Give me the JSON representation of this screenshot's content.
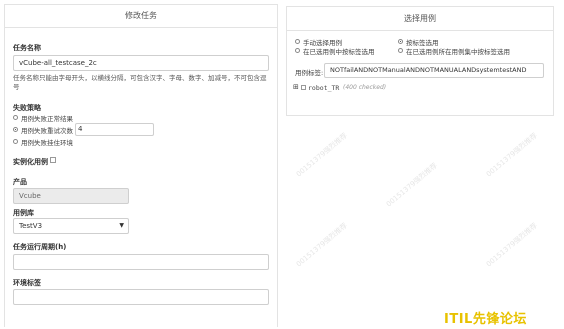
{
  "left_panel": {
    "title": "修改任务",
    "task_name": {
      "label": "任务名称",
      "value": "vCube-all_testcase_2c",
      "hint": "任务名称只能由字母开头，以横线分隔，可包含汉字、字母、数字、加减号，不可包含逗号"
    },
    "fail_strategy": {
      "label": "失败策略",
      "options": [
        "用例失败正常结果",
        "用例失败重试次数",
        "用例失败挂住环境"
      ],
      "selected_index": 1,
      "retry_count": "4"
    },
    "instantiate": {
      "label": "实例化用例"
    },
    "product": {
      "label": "产品",
      "value": "Vcube"
    },
    "case_library": {
      "label": "用例库",
      "value": "TestV3"
    },
    "run_period": {
      "label": "任务运行周期(h)",
      "value": ""
    },
    "env_tag": {
      "label": "环境标签",
      "value": ""
    }
  },
  "right_panel": {
    "title": "选择用例",
    "modes": [
      "手动选择用例",
      "按标签选用",
      "在已选用例中按标签选用",
      "在已选用例所在用例集中按标签选用"
    ],
    "selected_mode_index": 1,
    "tag_label": "用例标签:",
    "tag_value": "NOTfailANDNOTManualANDNOTMANUALANDsystemtestAND",
    "tree_root": "robot_TR",
    "tree_checked": "(400 checked)"
  },
  "watermark": "00151379强烈推荐",
  "brand": "ITIL先锋论坛"
}
